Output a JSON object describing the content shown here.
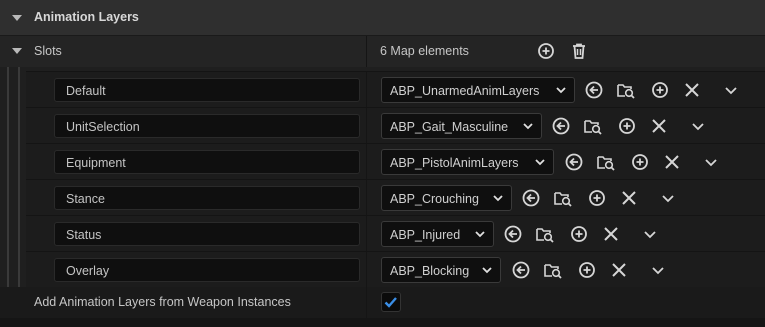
{
  "section": {
    "title": "Animation Layers"
  },
  "slots": {
    "label": "Slots",
    "count_text": "6 Map elements",
    "add_icon": "add-circle-icon",
    "delete_icon": "trash-icon"
  },
  "entries": [
    {
      "key": "Default",
      "value": "ABP_UnarmedAnimLayers"
    },
    {
      "key": "UnitSelection",
      "value": "ABP_Gait_Masculine"
    },
    {
      "key": "Equipment",
      "value": "ABP_PistolAnimLayers"
    },
    {
      "key": "Stance",
      "value": "ABP_Crouching"
    },
    {
      "key": "Status",
      "value": "ABP_Injured"
    },
    {
      "key": "Overlay",
      "value": "ABP_Blocking"
    }
  ],
  "entry_icons": [
    "use-selected-icon",
    "browse-icon",
    "insert-icon",
    "clear-icon",
    "chevron-down-icon"
  ],
  "footer": {
    "label": "Add Animation Layers from Weapon Instances",
    "checked": true
  },
  "colors": {
    "accent": "#3a8ee6",
    "icon": "#d6d6d6"
  }
}
